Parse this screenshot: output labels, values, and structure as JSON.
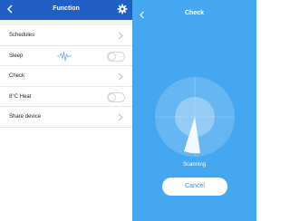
{
  "function_screen": {
    "title": "Function",
    "back_icon": "chevron-left-icon",
    "settings_icon": "gear-icon",
    "header_color": "#1f5fc6",
    "rows": [
      {
        "label": "Schedules",
        "control": "chevron"
      },
      {
        "label": "Sleep",
        "control": "toggle",
        "toggle_on": false,
        "extra_icon": "sleep-wave-icon"
      },
      {
        "label": "Check",
        "control": "chevron"
      },
      {
        "label": "8°C Heat",
        "control": "toggle",
        "toggle_on": false
      },
      {
        "label": "Share device",
        "control": "chevron"
      }
    ]
  },
  "check_screen": {
    "title": "Check",
    "back_icon": "chevron-left-icon",
    "background_color": "#45a7f0",
    "status": "Scanning",
    "cancel_label": "Cancel",
    "radar_icon": "radar-scan-icon"
  }
}
